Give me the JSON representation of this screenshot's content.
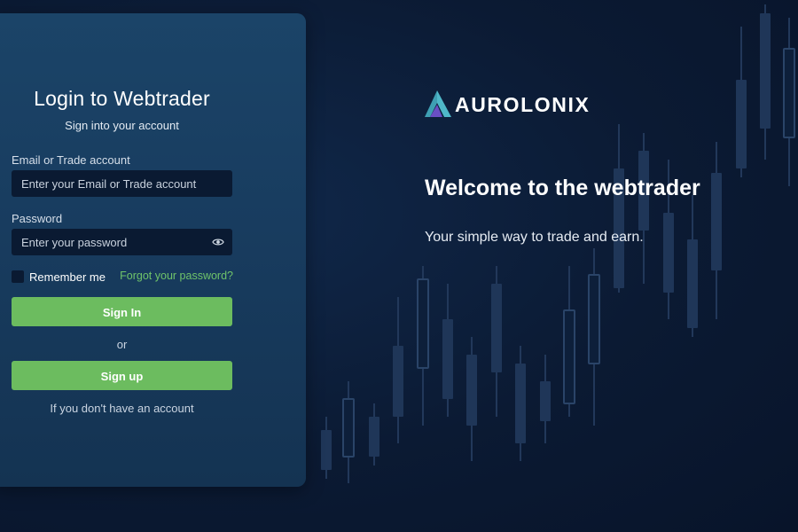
{
  "login": {
    "title": "Login to Webtrader",
    "subtitle": "Sign into your account",
    "email_label": "Email or Trade account",
    "email_placeholder": "Enter your Email or Trade account",
    "email_value": "",
    "password_label": "Password",
    "password_placeholder": "Enter your password",
    "password_value": "",
    "remember_label": "Remember me",
    "remember_checked": false,
    "forgot_link": "Forgot your password?",
    "signin_button": "Sign In",
    "or_text": "or",
    "signup_button": "Sign up",
    "footer_note": "If you don't have an account"
  },
  "brand": {
    "name": "AUROLONIX",
    "logo_icon": "triangle-logo-icon"
  },
  "welcome": {
    "title": "Welcome to the webtrader",
    "subtitle": "Your simple way to trade and earn."
  },
  "icons": {
    "password_toggle": "eye-icon"
  },
  "colors": {
    "background": "#0b1a33",
    "panel": "#183c5f",
    "input": "#0a1a32",
    "accent_green": "#6cbc5f",
    "link_green": "#6fc36a",
    "logo_teal": "#4fb8c9",
    "logo_purple": "#6a4fc4"
  }
}
